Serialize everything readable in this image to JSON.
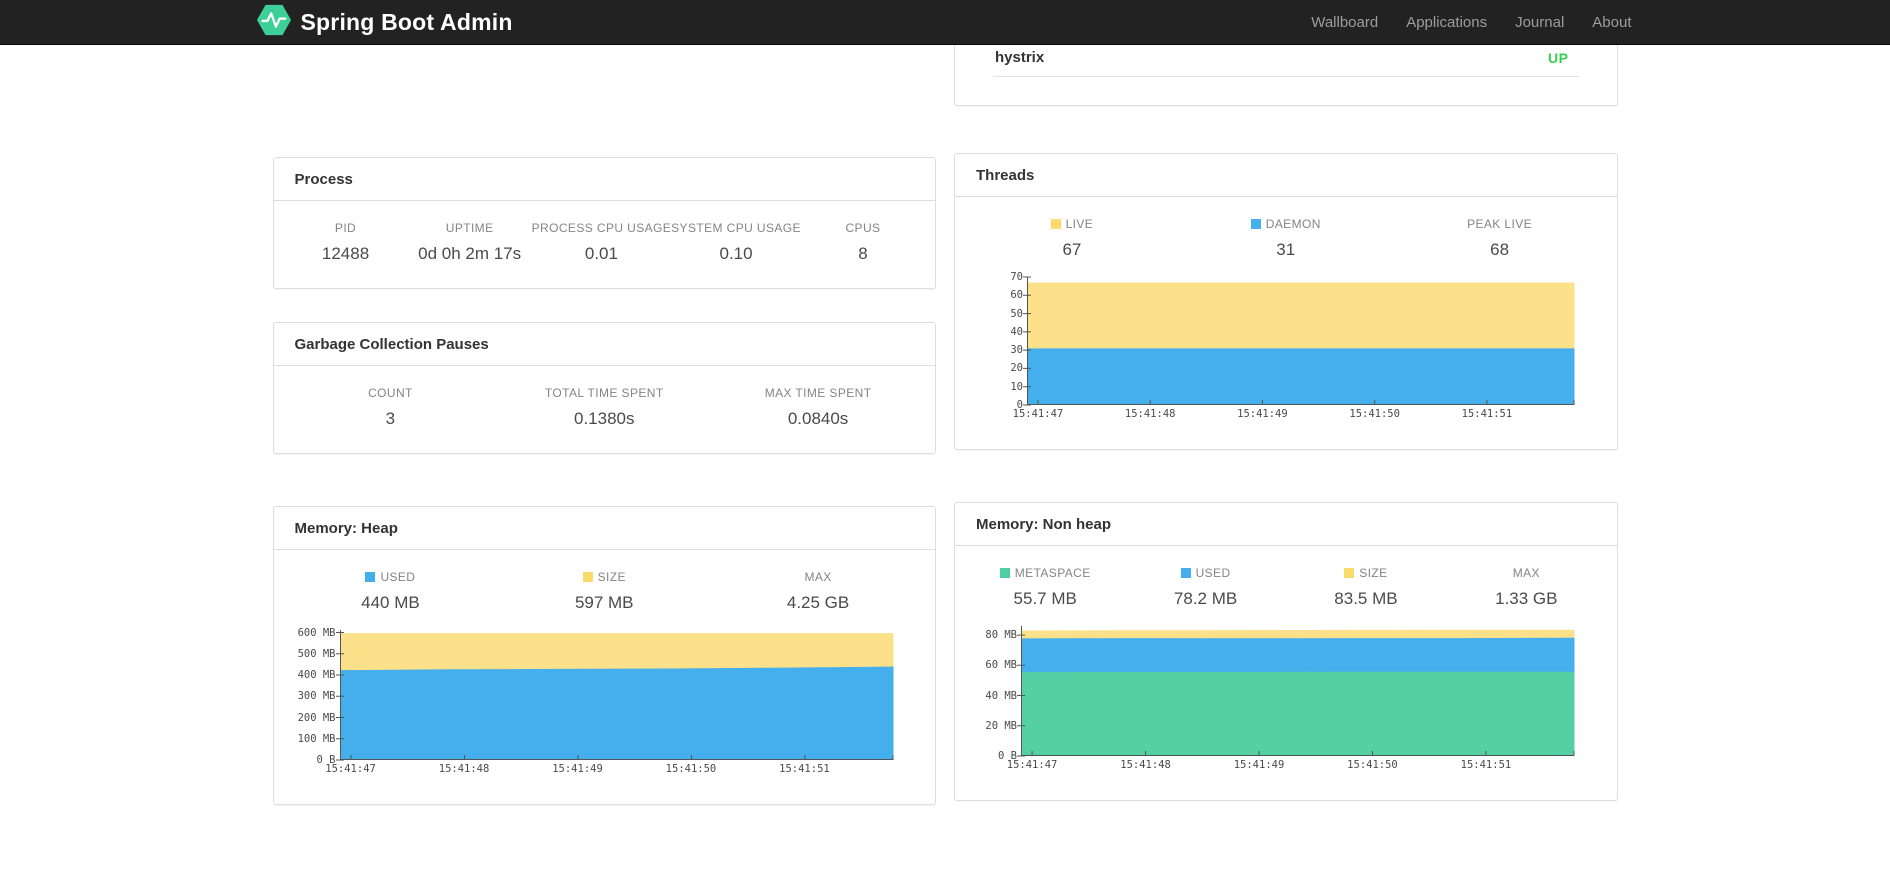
{
  "navbar": {
    "brand": "Spring Boot Admin",
    "links": [
      {
        "label": "Wallboard"
      },
      {
        "label": "Applications"
      },
      {
        "label": "Journal"
      },
      {
        "label": "About"
      }
    ]
  },
  "applications_panel": {
    "rows": [
      {
        "name": "hystrix",
        "status": "UP",
        "status_color": "#39ce51"
      }
    ]
  },
  "process": {
    "title": "Process",
    "metrics": [
      {
        "label": "PID",
        "value": "12488"
      },
      {
        "label": "UPTIME",
        "value": "0d 0h 2m 17s"
      },
      {
        "label": "PROCESS CPU USAGE",
        "value": "0.01"
      },
      {
        "label": "SYSTEM CPU USAGE",
        "value": "0.10"
      },
      {
        "label": "CPUS",
        "value": "8"
      }
    ]
  },
  "gc": {
    "title": "Garbage Collection Pauses",
    "metrics": [
      {
        "label": "COUNT",
        "value": "3"
      },
      {
        "label": "TOTAL TIME SPENT",
        "value": "0.1380s"
      },
      {
        "label": "MAX TIME SPENT",
        "value": "0.0840s"
      }
    ]
  },
  "threads": {
    "title": "Threads",
    "metrics": [
      {
        "label": "LIVE",
        "value": "67",
        "swatch": "#fbdb6b"
      },
      {
        "label": "DAEMON",
        "value": "31",
        "swatch": "#45aeed"
      },
      {
        "label": "PEAK LIVE",
        "value": "68"
      }
    ]
  },
  "heap": {
    "title": "Memory: Heap",
    "metrics": [
      {
        "label": "USED",
        "value": "440 MB",
        "swatch": "#45aeed"
      },
      {
        "label": "SIZE",
        "value": "597 MB",
        "swatch": "#fbdb6b"
      },
      {
        "label": "MAX",
        "value": "4.25 GB"
      }
    ]
  },
  "nonheap": {
    "title": "Memory: Non heap",
    "metrics": [
      {
        "label": "METASPACE",
        "value": "55.7 MB",
        "swatch": "#4fcea0"
      },
      {
        "label": "USED",
        "value": "78.2 MB",
        "swatch": "#45aeed"
      },
      {
        "label": "SIZE",
        "value": "83.5 MB",
        "swatch": "#fbdb6b"
      },
      {
        "label": "MAX",
        "value": "1.33 GB"
      }
    ]
  },
  "colors": {
    "brand_green": "#3ece97",
    "chart_yellow": "#fce08a",
    "chart_blue": "#45aeed",
    "chart_green": "#55d0a4",
    "status_up": "#39ce51"
  },
  "chart_data": [
    {
      "type": "area",
      "title": "Threads",
      "legend_position": "top",
      "grid": false,
      "ymax": 70,
      "y_ticks": [
        {
          "v": 0,
          "label": "0"
        },
        {
          "v": 10,
          "label": "10"
        },
        {
          "v": 20,
          "label": "20"
        },
        {
          "v": 30,
          "label": "30"
        },
        {
          "v": 40,
          "label": "40"
        },
        {
          "v": 50,
          "label": "50"
        },
        {
          "v": 60,
          "label": "60"
        },
        {
          "v": 70,
          "label": "70"
        }
      ],
      "x_ticks": [
        "15:41:47",
        "15:41:48",
        "15:41:49",
        "15:41:50",
        "15:41:51"
      ],
      "series": [
        {
          "name": "LIVE",
          "color": "#fce08a",
          "values": [
            67,
            67,
            67,
            67,
            67,
            67
          ]
        },
        {
          "name": "DAEMON",
          "color": "#45aeed",
          "values": [
            31,
            31,
            31,
            31,
            31,
            31
          ]
        }
      ]
    },
    {
      "type": "area",
      "title": "Memory: Heap",
      "legend_position": "top",
      "grid": false,
      "ymax": 612,
      "y_ticks": [
        {
          "v": 0,
          "label": "0 B"
        },
        {
          "v": 100,
          "label": "100 MB"
        },
        {
          "v": 200,
          "label": "200 MB"
        },
        {
          "v": 300,
          "label": "300 MB"
        },
        {
          "v": 400,
          "label": "400 MB"
        },
        {
          "v": 500,
          "label": "500 MB"
        },
        {
          "v": 600,
          "label": "600 MB"
        }
      ],
      "x_ticks": [
        "15:41:47",
        "15:41:48",
        "15:41:49",
        "15:41:50",
        "15:41:51"
      ],
      "series": [
        {
          "name": "SIZE",
          "color": "#fce08a",
          "values": [
            597,
            597,
            597,
            597,
            597,
            597
          ]
        },
        {
          "name": "USED",
          "color": "#45aeed",
          "values": [
            423,
            427,
            429,
            431,
            435,
            440
          ]
        }
      ]
    },
    {
      "type": "area",
      "title": "Memory: Non heap",
      "legend_position": "top",
      "grid": false,
      "ymax": 86,
      "y_ticks": [
        {
          "v": 0,
          "label": "0 B"
        },
        {
          "v": 20,
          "label": "20 MB"
        },
        {
          "v": 40,
          "label": "40 MB"
        },
        {
          "v": 60,
          "label": "60 MB"
        },
        {
          "v": 80,
          "label": "80 MB"
        }
      ],
      "x_ticks": [
        "15:41:47",
        "15:41:48",
        "15:41:49",
        "15:41:50",
        "15:41:51"
      ],
      "series": [
        {
          "name": "SIZE",
          "color": "#fce08a",
          "values": [
            83,
            83.2,
            83.3,
            83.4,
            83.5,
            83.5
          ]
        },
        {
          "name": "USED",
          "color": "#45aeed",
          "values": [
            77.8,
            78,
            77.9,
            78,
            78,
            78.2
          ]
        },
        {
          "name": "METASPACE",
          "color": "#55d0a4",
          "values": [
            55.5,
            55.6,
            55.6,
            55.7,
            55.7,
            55.7
          ]
        }
      ]
    }
  ]
}
